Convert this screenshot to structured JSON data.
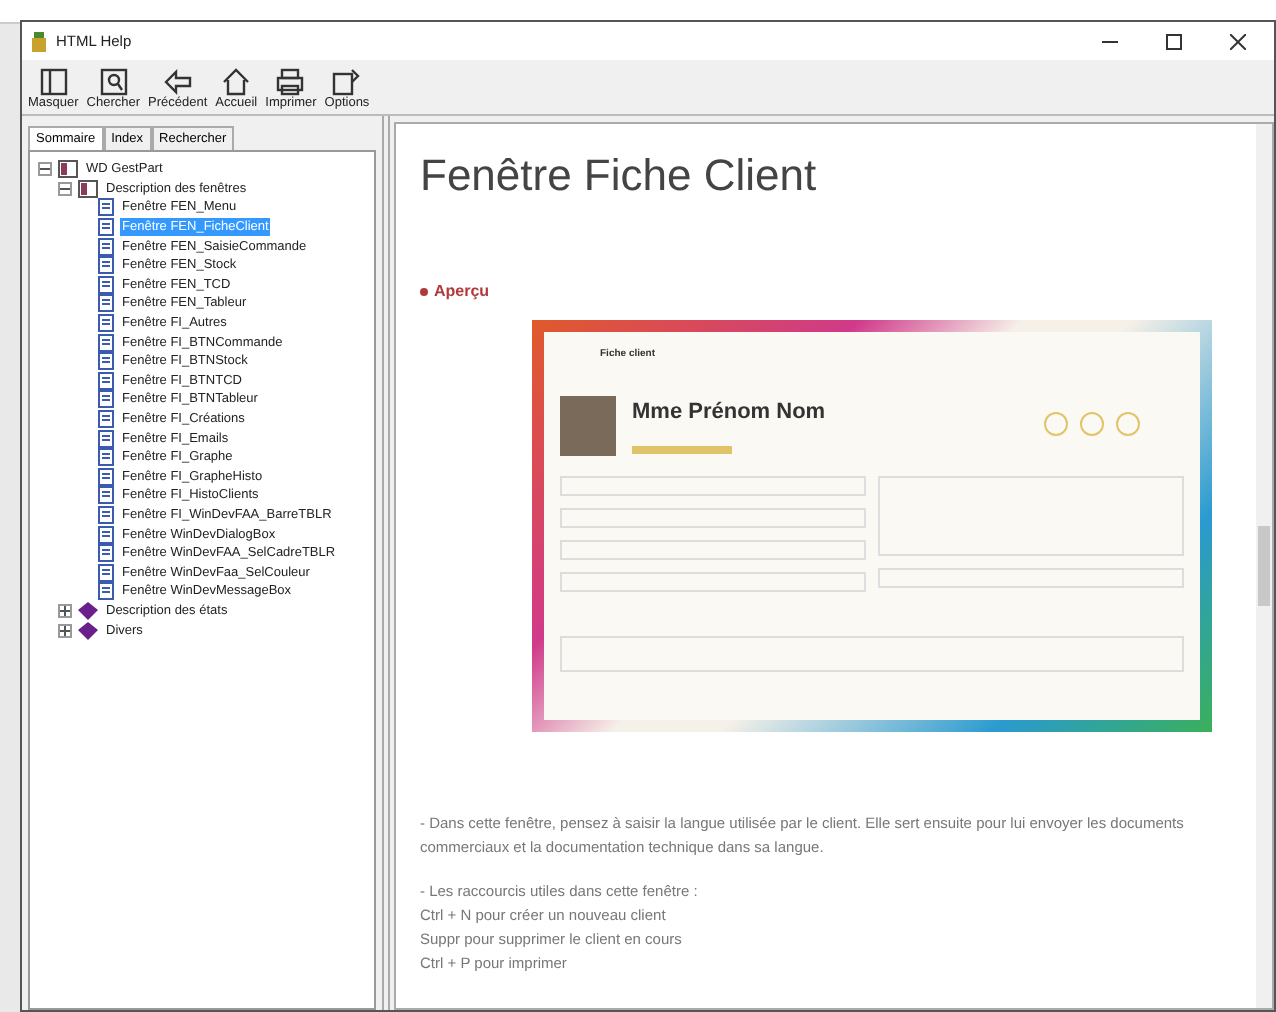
{
  "window": {
    "title": "HTML Help"
  },
  "toolbar": [
    {
      "label": "Masquer",
      "kind": "hide"
    },
    {
      "label": "Chercher",
      "kind": "find"
    },
    {
      "label": "Précédent",
      "kind": "back"
    },
    {
      "label": "Accueil",
      "kind": "home"
    },
    {
      "label": "Imprimer",
      "kind": "print"
    },
    {
      "label": "Options",
      "kind": "options"
    }
  ],
  "tabs": [
    {
      "label": "Sommaire",
      "selected": true
    },
    {
      "label": "Index",
      "selected": false
    },
    {
      "label": "Rechercher",
      "selected": false
    }
  ],
  "tree": [
    {
      "label": "WD GestPart",
      "kind": "book",
      "expanded": true,
      "selected": false,
      "children": [
        {
          "label": "Description des fenêtres",
          "kind": "book",
          "expanded": true,
          "selected": false,
          "children": [
            {
              "label": "Fenêtre FEN_Menu",
              "kind": "page",
              "selected": false
            },
            {
              "label": "Fenêtre FEN_FicheClient",
              "kind": "page",
              "selected": true
            },
            {
              "label": "Fenêtre FEN_SaisieCommande",
              "kind": "page",
              "selected": false
            },
            {
              "label": "Fenêtre FEN_Stock",
              "kind": "page",
              "selected": false
            },
            {
              "label": "Fenêtre FEN_TCD",
              "kind": "page",
              "selected": false
            },
            {
              "label": "Fenêtre FEN_Tableur",
              "kind": "page",
              "selected": false
            },
            {
              "label": "Fenêtre FI_Autres",
              "kind": "page",
              "selected": false
            },
            {
              "label": "Fenêtre FI_BTNCommande",
              "kind": "page",
              "selected": false
            },
            {
              "label": "Fenêtre FI_BTNStock",
              "kind": "page",
              "selected": false
            },
            {
              "label": "Fenêtre FI_BTNTCD",
              "kind": "page",
              "selected": false
            },
            {
              "label": "Fenêtre FI_BTNTableur",
              "kind": "page",
              "selected": false
            },
            {
              "label": "Fenêtre FI_Créations",
              "kind": "page",
              "selected": false
            },
            {
              "label": "Fenêtre FI_Emails",
              "kind": "page",
              "selected": false
            },
            {
              "label": "Fenêtre FI_Graphe",
              "kind": "page",
              "selected": false
            },
            {
              "label": "Fenêtre FI_GrapheHisto",
              "kind": "page",
              "selected": false
            },
            {
              "label": "Fenêtre FI_HistoClients",
              "kind": "page",
              "selected": false
            },
            {
              "label": "Fenêtre FI_WinDevFAA_BarreTBLR",
              "kind": "page",
              "selected": false
            },
            {
              "label": "Fenêtre WinDevDialogBox",
              "kind": "page",
              "selected": false
            },
            {
              "label": "Fenêtre WinDevFAA_SelCadreTBLR",
              "kind": "page",
              "selected": false
            },
            {
              "label": "Fenêtre WinDevFaa_SelCouleur",
              "kind": "page",
              "selected": false
            },
            {
              "label": "Fenêtre WinDevMessageBox",
              "kind": "page",
              "selected": false
            }
          ]
        },
        {
          "label": "Description des états",
          "kind": "gem",
          "expanded": false,
          "selected": false
        },
        {
          "label": "Divers",
          "kind": "gem",
          "expanded": false,
          "selected": false
        }
      ]
    }
  ],
  "content": {
    "title": "Fenêtre Fiche Client",
    "section": "Aperçu",
    "preview": {
      "title": "Fiche client",
      "name": "Mme Prénom Nom"
    },
    "paragraphs": [
      "- Dans cette fenêtre, pensez à saisir la langue utilisée par le client. Elle sert ensuite pour lui envoyer les documents commerciaux et la documentation technique dans sa langue."
    ],
    "shortcuts": [
      "- Les raccourcis utiles dans cette fenêtre :",
      "Ctrl + N pour créer un nouveau client",
      "Suppr pour supprimer le client en cours",
      "Ctrl + P pour imprimer"
    ]
  }
}
